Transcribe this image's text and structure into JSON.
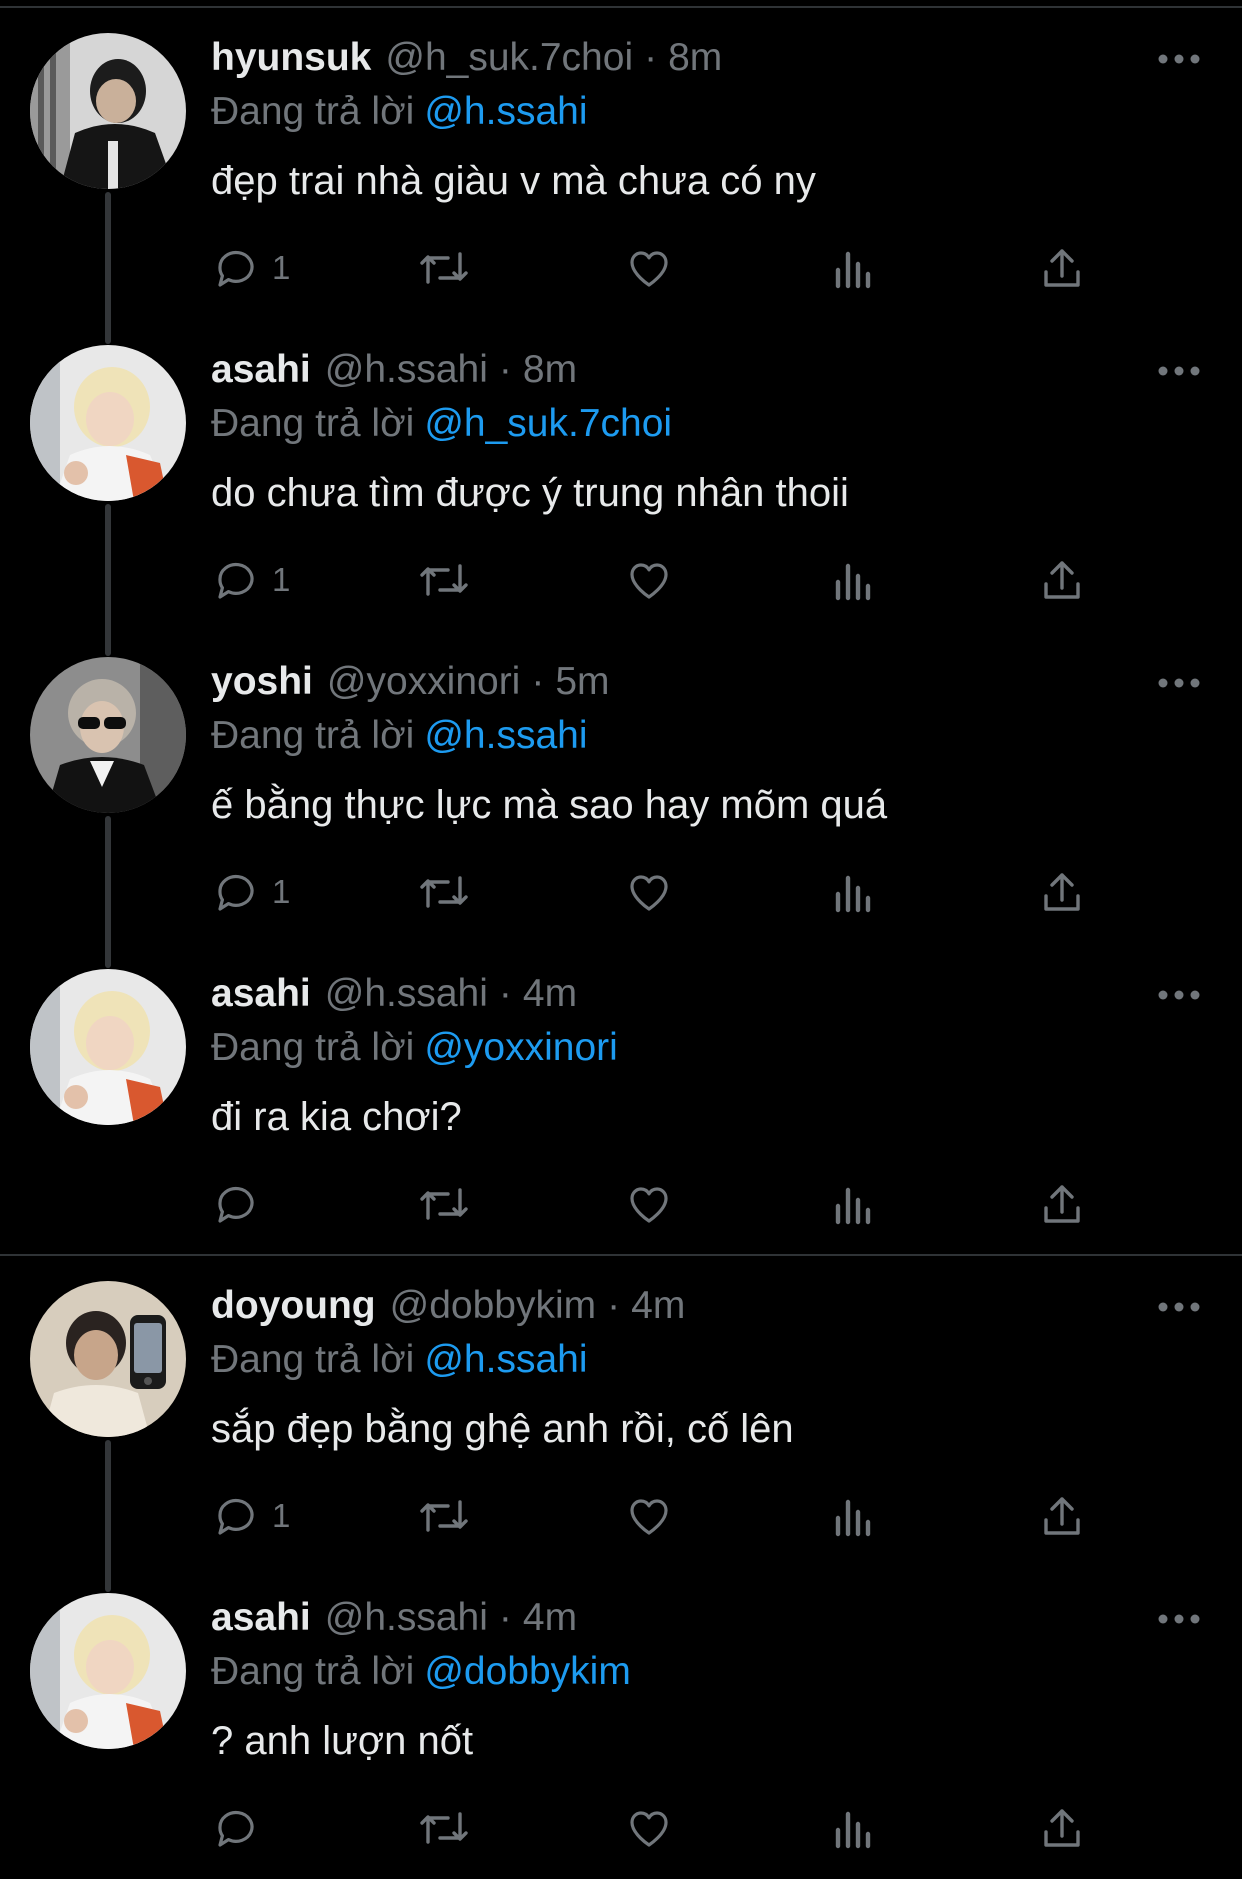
{
  "colors": {
    "background": "#000000",
    "text": "#e7e9ea",
    "secondary": "#71767b",
    "accent": "#1d9bf0",
    "divider": "#2f3336"
  },
  "reply_prefix": "Đang trả lời",
  "tweets": [
    {
      "name": "hyunsuk",
      "handle": "@h_suk.7choi",
      "time": "8m",
      "replying_to": "@h.ssahi",
      "text": "đẹp trai nhà giàu v mà chưa có ny",
      "reply_count": "1",
      "avatar_icon": "avatar-hyunsuk"
    },
    {
      "name": "asahi",
      "handle": "@h.ssahi",
      "time": "8m",
      "replying_to": "@h_suk.7choi",
      "text": "do chưa tìm được ý trung nhân thoii",
      "reply_count": "1",
      "avatar_icon": "avatar-asahi"
    },
    {
      "name": "yoshi",
      "handle": "@yoxxinori",
      "time": "5m",
      "replying_to": "@h.ssahi",
      "text": "ế bằng thực lực mà sao hay mõm quá",
      "reply_count": "1",
      "avatar_icon": "avatar-yoshi"
    },
    {
      "name": "asahi",
      "handle": "@h.ssahi",
      "time": "4m",
      "replying_to": "@yoxxinori",
      "text": "đi ra kia chơi?",
      "reply_count": "",
      "avatar_icon": "avatar-asahi"
    },
    {
      "name": "doyoung",
      "handle": "@dobbykim",
      "time": "4m",
      "replying_to": "@h.ssahi",
      "text": "sắp đẹp bằng ghệ anh rồi, cố lên",
      "reply_count": "1",
      "avatar_icon": "avatar-doyoung"
    },
    {
      "name": "asahi",
      "handle": "@h.ssahi",
      "time": "4m",
      "replying_to": "@dobbykim",
      "text": "? anh lượn nốt",
      "reply_count": "",
      "avatar_icon": "avatar-asahi"
    }
  ]
}
